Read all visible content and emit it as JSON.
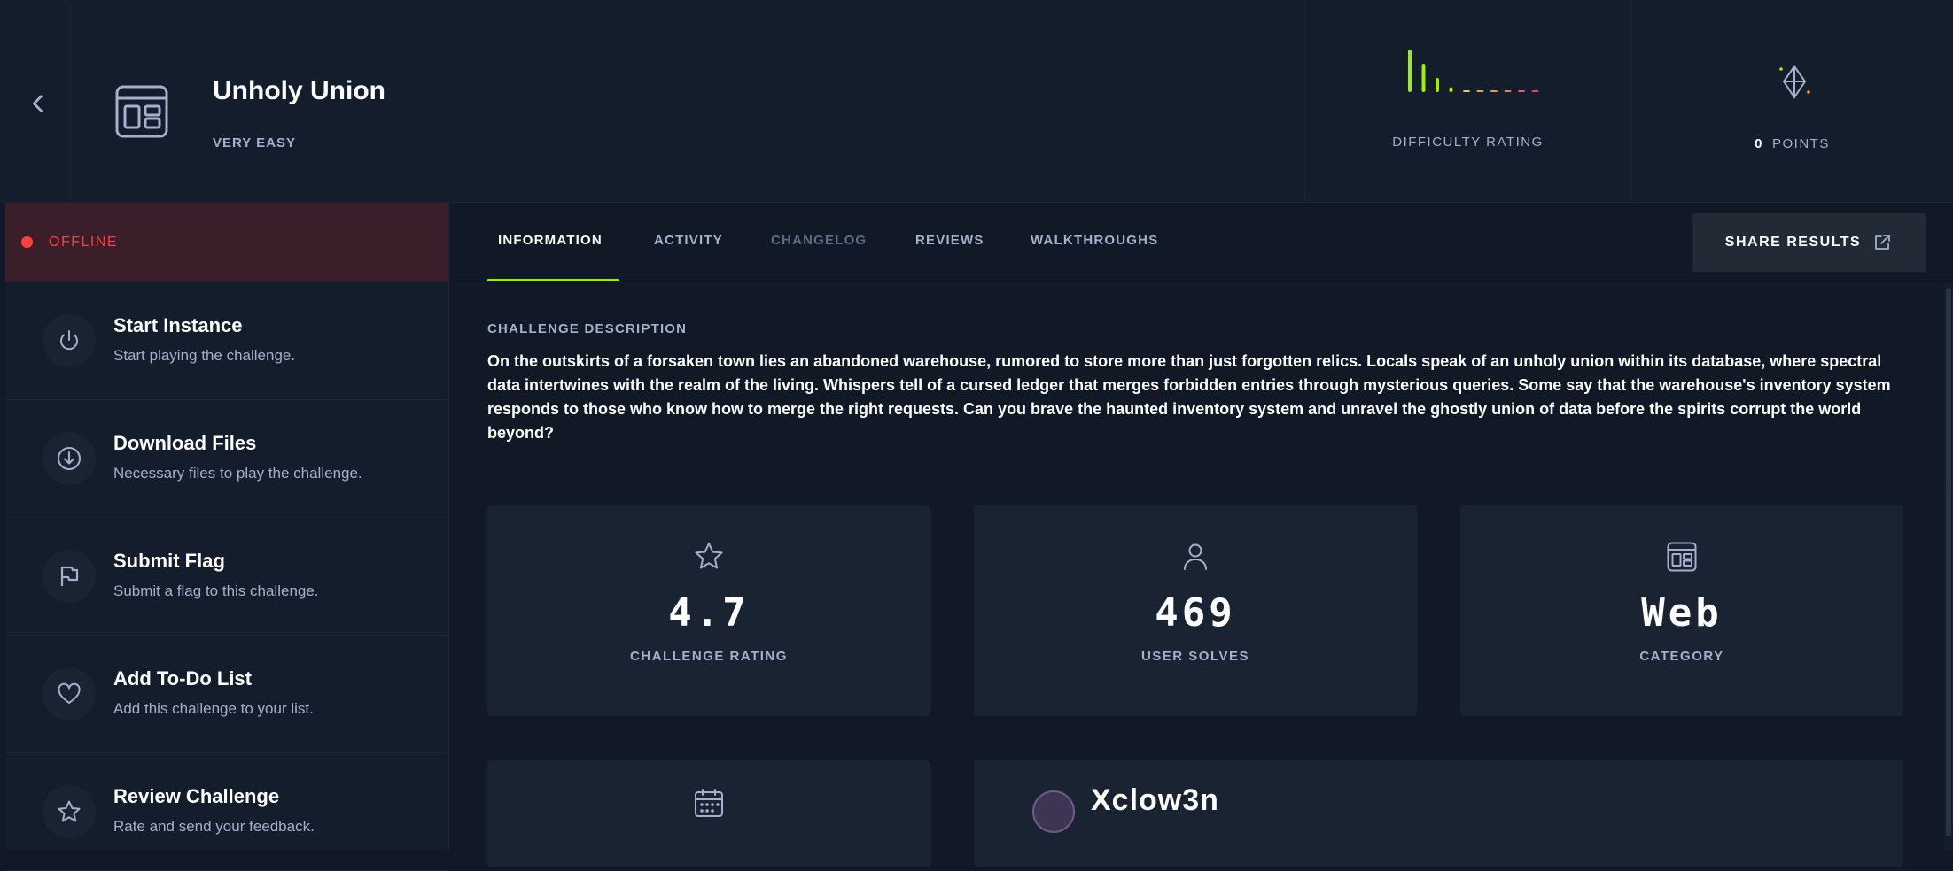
{
  "header": {
    "title": "Unholy Union",
    "difficulty_level": "VERY EASY",
    "difficulty_rating_label": "DIFFICULTY RATING",
    "points_value": "0",
    "points_label": "POINTS"
  },
  "difficulty_votes": [
    9,
    6,
    3,
    1,
    0,
    0,
    0,
    0,
    0,
    0
  ],
  "status": {
    "label": "OFFLINE",
    "color": "#ff3e3e"
  },
  "actions": [
    {
      "title": "Start Instance",
      "desc": "Start playing the challenge.",
      "icon": "power-icon"
    },
    {
      "title": "Download Files",
      "desc": "Necessary files to play the challenge.",
      "icon": "download-icon"
    },
    {
      "title": "Submit Flag",
      "desc": "Submit a flag to this challenge.",
      "icon": "flag-icon"
    },
    {
      "title": "Add To-Do List",
      "desc": "Add this challenge to your list.",
      "icon": "heart-icon"
    },
    {
      "title": "Review Challenge",
      "desc": "Rate and send your feedback.",
      "icon": "star-icon"
    }
  ],
  "tabs": [
    {
      "label": "INFORMATION",
      "state": "active"
    },
    {
      "label": "ACTIVITY",
      "state": "normal"
    },
    {
      "label": "CHANGELOG",
      "state": "disabled"
    },
    {
      "label": "REVIEWS",
      "state": "normal"
    },
    {
      "label": "WALKTHROUGHS",
      "state": "normal"
    }
  ],
  "share_label": "SHARE RESULTS",
  "description": {
    "heading": "CHALLENGE DESCRIPTION",
    "body": "On the outskirts of a forsaken town lies an abandoned warehouse, rumored to store more than just forgotten relics. Locals speak of an unholy union within its database, where spectral data intertwines with the realm of the living. Whispers tell of a cursed ledger that merges forbidden entries through mysterious queries. Some say that the warehouse's inventory system responds to those who know how to merge the right requests. Can you brave the haunted inventory system and unravel the ghostly union of data before the spirits corrupt the world beyond?"
  },
  "stats": [
    {
      "value": "4.7",
      "label": "CHALLENGE RATING",
      "icon": "star-outline-icon"
    },
    {
      "value": "469",
      "label": "USER SOLVES",
      "icon": "user-icon"
    },
    {
      "value": "Web",
      "label": "CATEGORY",
      "icon": "web-category-icon"
    }
  ],
  "creator": {
    "name": "Xclow3n"
  },
  "colors": {
    "accent": "#9fef00",
    "danger": "#ff3e3e",
    "background": "#111927",
    "panel": "#141d2b",
    "card": "#1a2332"
  }
}
